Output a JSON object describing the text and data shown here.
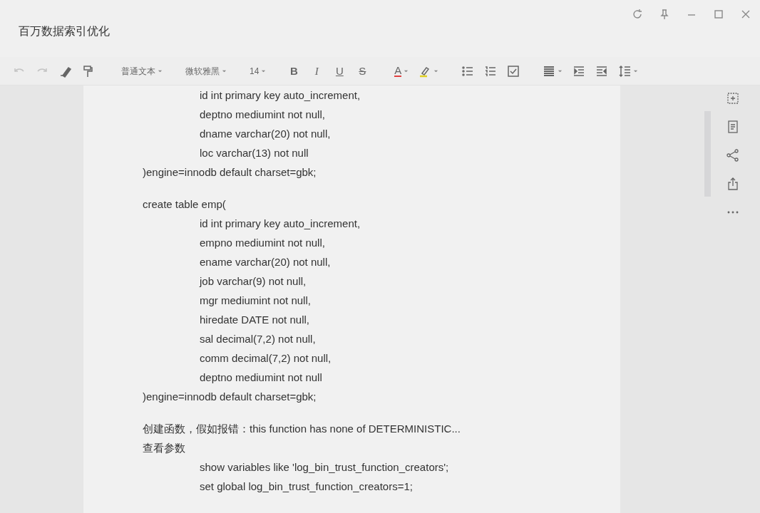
{
  "window": {
    "title": "百万数据索引优化"
  },
  "toolbar": {
    "history": [
      {
        "kind": "undo",
        "disabled": true
      },
      {
        "kind": "redo",
        "disabled": true
      }
    ],
    "dropdowns": [
      {
        "value": "普通文本"
      },
      {
        "value": "微软雅黑"
      },
      {
        "value": "14"
      }
    ],
    "format": [
      {
        "kind": "bold",
        "label": "B"
      },
      {
        "kind": "italic",
        "label": "I"
      },
      {
        "kind": "underline",
        "label": "U"
      },
      {
        "kind": "strike",
        "label": "S"
      }
    ],
    "font_color": {
      "label": "A"
    }
  },
  "document": {
    "sections": [
      {
        "lines": [
          {
            "children": [
              {
                "text": "id int primary key auto_increment,"
              },
              {
                "text": "deptno mediumint not null,"
              },
              {
                "text": "dname varchar(20) not null,"
              },
              {
                "text": "loc varchar(13) not null"
              }
            ]
          },
          {
            "text": ")engine=innodb default charset=gbk;"
          }
        ]
      },
      {
        "lines": [
          {
            "text": "create table emp(",
            "children": [
              {
                "text": "id int primary key auto_increment,"
              },
              {
                "text": "empno mediumint not null,"
              },
              {
                "text": "ename varchar(20) not null,"
              },
              {
                "text": "job varchar(9) not null,"
              },
              {
                "text": "mgr mediumint not null,"
              },
              {
                "text": "hiredate DATE not null,"
              },
              {
                "text": "sal decimal(7,2) not null,"
              },
              {
                "text": "comm decimal(7,2) not  null,"
              },
              {
                "text": "deptno mediumint not null"
              }
            ]
          },
          {
            "text": ")engine=innodb default charset=gbk;"
          }
        ]
      },
      {
        "lines": [
          {
            "text": "创建函数，假如报错：this function has none of  DETERMINISTIC..."
          },
          {
            "text": "查看参数",
            "children": [
              {
                "text": "show variables like 'log_bin_trust_function_creators';"
              },
              {
                "text": "set global log_bin_trust_function_creators=1;"
              }
            ]
          }
        ]
      }
    ]
  }
}
